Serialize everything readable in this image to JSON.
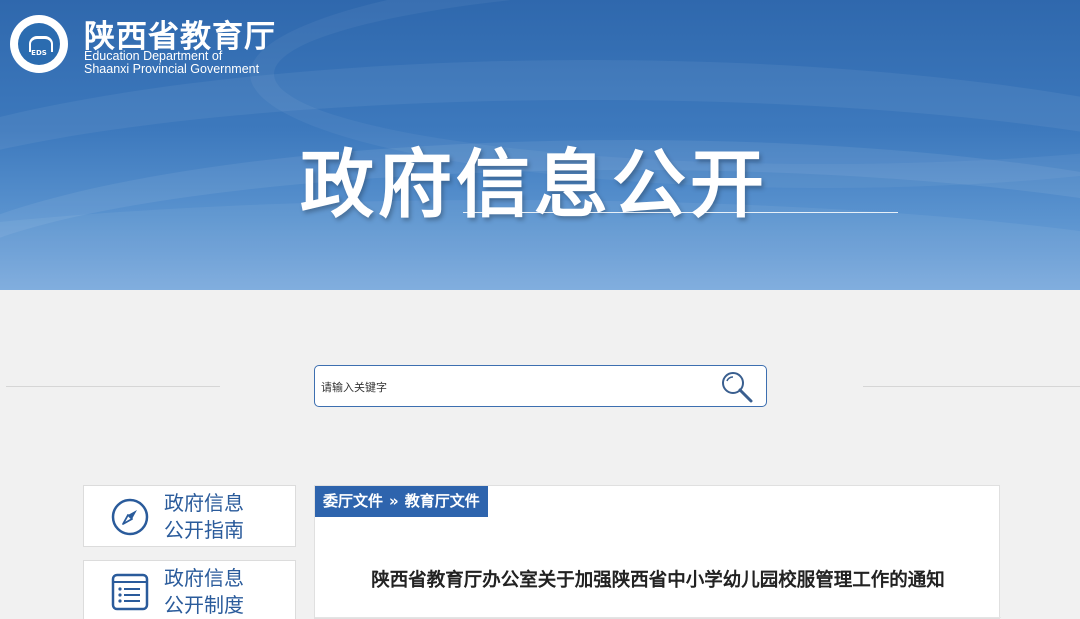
{
  "header": {
    "logo_cn": "陕西省教育厅",
    "logo_en_line1": "Education Department of",
    "logo_en_line2": "Shaanxi Provincial Government",
    "logo_seal_text": "EDS",
    "banner_title": "政府信息公开"
  },
  "search": {
    "placeholder": "请输入关键字",
    "icon": "search-icon"
  },
  "sidebar": {
    "items": [
      {
        "line1": "政府信息",
        "line2": "公开指南",
        "icon": "compass-icon"
      },
      {
        "line1": "政府信息",
        "line2": "公开制度",
        "icon": "list-document-icon"
      }
    ]
  },
  "breadcrumb": {
    "level1": "委厅文件",
    "separator": "»",
    "level2": "教育厅文件"
  },
  "article": {
    "title": "陕西省教育厅办公室关于加强陕西省中小学幼儿园校服管理工作的通知"
  },
  "colors": {
    "brand_blue": "#2e64ad",
    "sidebar_text": "#2a5b9b",
    "page_bg": "#f1f1f1"
  }
}
